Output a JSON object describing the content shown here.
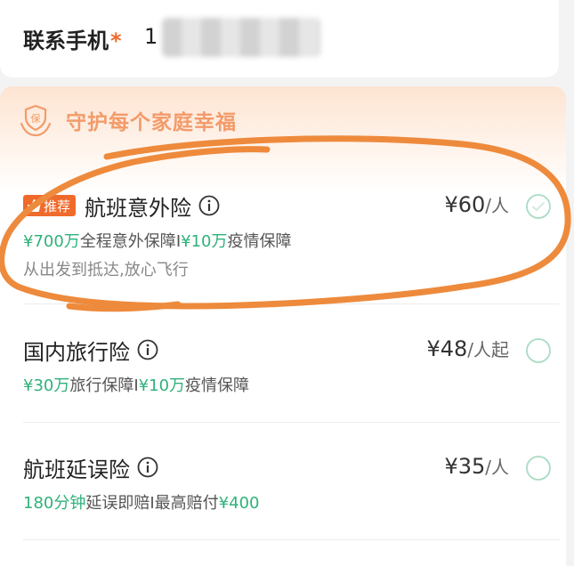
{
  "contact": {
    "label": "联系手机",
    "required_mark": "*",
    "phone_prefix": "1"
  },
  "insurance": {
    "slogan": "守护每个家庭幸福",
    "slogan_icon_char": "保",
    "products": [
      {
        "badge": "推荐",
        "name": "航班意外险",
        "price": "¥60",
        "unit": "/人",
        "desc_parts": [
          {
            "text": "¥700万",
            "hl": true
          },
          {
            "text": "全程意外保障",
            "hl": false
          },
          {
            "text": "I",
            "hl": false
          },
          {
            "text": "¥10万",
            "hl": true
          },
          {
            "text": "疫情保障",
            "hl": false
          }
        ],
        "subtitle": "从出发到抵达,放心飞行",
        "selected": false
      },
      {
        "name": "国内旅行险",
        "price": "¥48",
        "unit": "/人起",
        "desc_parts": [
          {
            "text": "¥30万",
            "hl": true
          },
          {
            "text": "旅行保障",
            "hl": false
          },
          {
            "text": "I",
            "hl": false
          },
          {
            "text": "¥10万",
            "hl": true
          },
          {
            "text": "疫情保障",
            "hl": false
          }
        ],
        "selected": false
      },
      {
        "name": "航班延误险",
        "price": "¥35",
        "unit": "/人",
        "desc_parts": [
          {
            "text": "180分钟",
            "hl": true
          },
          {
            "text": "延误即赔",
            "hl": false
          },
          {
            "text": "I",
            "hl": false
          },
          {
            "text": "最高赔付",
            "hl": false
          },
          {
            "text": "¥400",
            "hl": true
          }
        ],
        "selected": false
      }
    ]
  },
  "colors": {
    "accent_orange": "#f06a2b",
    "highlight_green": "#2fb27a",
    "annotation_orange": "#ee8a3c"
  }
}
